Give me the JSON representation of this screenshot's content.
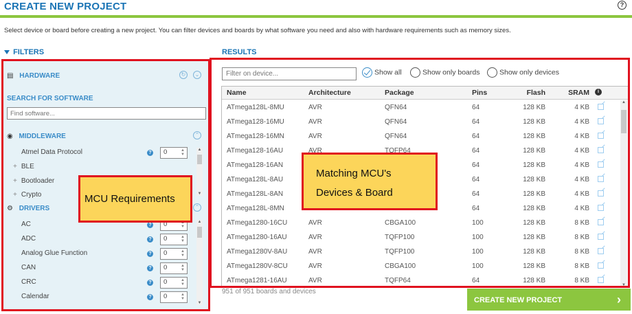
{
  "header": {
    "title": "CREATE NEW PROJECT",
    "help": "?",
    "description": "Select device or board before creating a new project. You can filter devices and boards by what software you need and also with hardware requirements such as memory sizes."
  },
  "filters": {
    "heading": "FILTERS",
    "hardware_label": "HARDWARE",
    "search_software_label": "SEARCH FOR SOFTWARE",
    "search_software_placeholder": "Find software...",
    "middleware_label": "MIDDLEWARE",
    "middleware_items": [
      {
        "label": "Atmel Data Protocol",
        "value": "0",
        "expandable": false
      },
      {
        "label": "BLE",
        "expandable": true
      },
      {
        "label": "Bootloader",
        "expandable": true
      },
      {
        "label": "Crypto",
        "expandable": true
      }
    ],
    "drivers_label": "DRIVERS",
    "driver_items": [
      {
        "label": "AC",
        "value": "0"
      },
      {
        "label": "ADC",
        "value": "0"
      },
      {
        "label": "Analog Glue Function",
        "value": "0"
      },
      {
        "label": "CAN",
        "value": "0"
      },
      {
        "label": "CRC",
        "value": "0"
      },
      {
        "label": "Calendar",
        "value": "0"
      }
    ]
  },
  "results": {
    "heading": "RESULTS",
    "filter_placeholder": "Filter on device...",
    "radio_options": [
      {
        "label": "Show all",
        "checked": true
      },
      {
        "label": "Show only boards",
        "checked": false
      },
      {
        "label": "Show only devices",
        "checked": false
      }
    ],
    "columns": {
      "name": "Name",
      "architecture": "Architecture",
      "package": "Package",
      "pins": "Pins",
      "flash": "Flash",
      "sram": "SRAM"
    },
    "rows": [
      {
        "name": "ATmega128L-8MU",
        "arch": "AVR",
        "pkg": "QFN64",
        "pins": "64",
        "flash": "128 KB",
        "sram": "4 KB"
      },
      {
        "name": "ATmega128-16MU",
        "arch": "AVR",
        "pkg": "QFN64",
        "pins": "64",
        "flash": "128 KB",
        "sram": "4 KB"
      },
      {
        "name": "ATmega128-16MN",
        "arch": "AVR",
        "pkg": "QFN64",
        "pins": "64",
        "flash": "128 KB",
        "sram": "4 KB"
      },
      {
        "name": "ATmega128-16AU",
        "arch": "AVR",
        "pkg": "TQFP64",
        "pins": "64",
        "flash": "128 KB",
        "sram": "4 KB"
      },
      {
        "name": "ATmega128-16AN",
        "arch": "",
        "pkg": "",
        "pins": "64",
        "flash": "128 KB",
        "sram": "4 KB"
      },
      {
        "name": "ATmega128L-8AU",
        "arch": "",
        "pkg": "",
        "pins": "64",
        "flash": "128 KB",
        "sram": "4 KB"
      },
      {
        "name": "ATmega128L-8AN",
        "arch": "",
        "pkg": "",
        "pins": "64",
        "flash": "128 KB",
        "sram": "4 KB"
      },
      {
        "name": "ATmega128L-8MN",
        "arch": "",
        "pkg": "",
        "pins": "64",
        "flash": "128 KB",
        "sram": "4 KB"
      },
      {
        "name": "ATmega1280-16CU",
        "arch": "AVR",
        "pkg": "CBGA100",
        "pins": "100",
        "flash": "128 KB",
        "sram": "8 KB"
      },
      {
        "name": "ATmega1280-16AU",
        "arch": "AVR",
        "pkg": "TQFP100",
        "pins": "100",
        "flash": "128 KB",
        "sram": "8 KB"
      },
      {
        "name": "ATmega1280V-8AU",
        "arch": "AVR",
        "pkg": "TQFP100",
        "pins": "100",
        "flash": "128 KB",
        "sram": "8 KB"
      },
      {
        "name": "ATmega1280V-8CU",
        "arch": "AVR",
        "pkg": "CBGA100",
        "pins": "100",
        "flash": "128 KB",
        "sram": "8 KB"
      },
      {
        "name": "ATmega1281-16AU",
        "arch": "AVR",
        "pkg": "TQFP64",
        "pins": "64",
        "flash": "128 KB",
        "sram": "8 KB"
      }
    ],
    "count_text": "951 of 951 boards and devices",
    "create_button": "CREATE NEW PROJECT"
  },
  "annotations": {
    "mcu_requirements": "MCU Requirements",
    "matching_line1": "Matching MCU's",
    "matching_line2": "Devices & Board"
  },
  "colors": {
    "accent_blue": "#1a74b5",
    "brand_green": "#8cc63f",
    "highlight_red": "#e0121f",
    "note_yellow": "#fcd55a"
  }
}
